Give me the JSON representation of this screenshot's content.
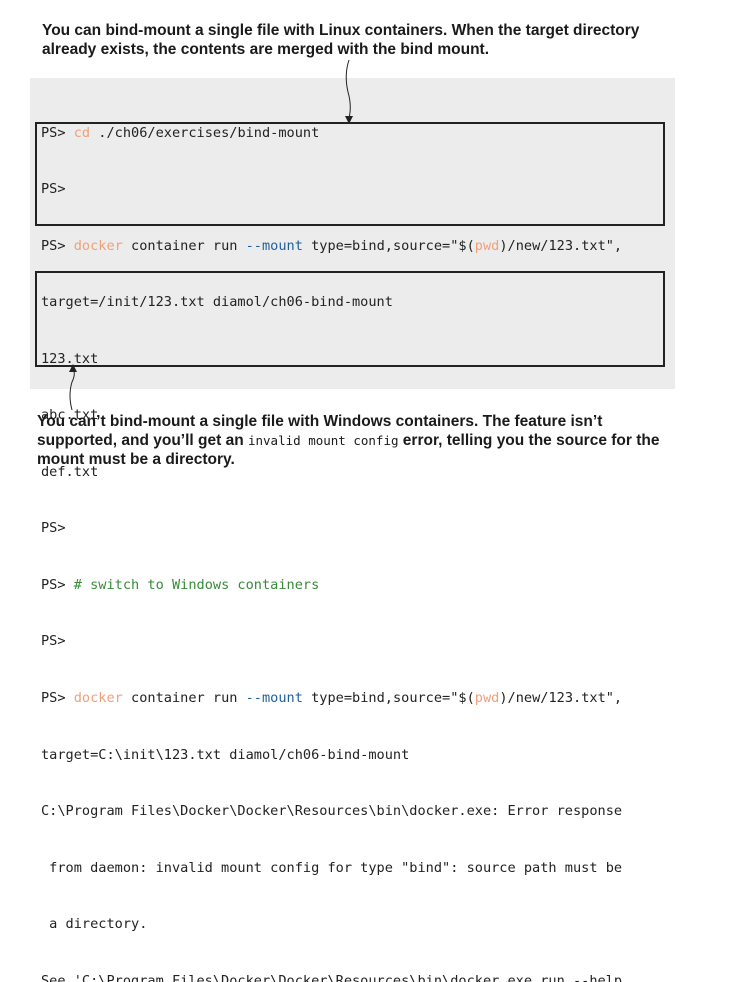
{
  "annotations": {
    "top": "You can bind-mount a single file with Linux containers. When the target directory already exists, the contents are merged with the bind mount.",
    "bottom_part1": "You can’t bind-mount a single file with Windows containers. The feature isn’t supported, and you’ll get an ",
    "bottom_code": "invalid mount config",
    "bottom_part2": " error, telling you the source for the mount must be a directory."
  },
  "terminal": {
    "prompt": "PS> ",
    "l1_cmd": "cd",
    "l1_rest": " ./ch06/exercises/bind-mount",
    "l2": "PS>",
    "l3_cmd": "docker",
    "l3_a": " container run ",
    "l3_opt": "--mount",
    "l3_b": " type=bind,source=\"$(",
    "l3_pwd": "pwd",
    "l3_c": ")/new/123.txt\",",
    "l4": "target=/init/123.txt diamol/ch06-bind-mount",
    "l5": "123.txt",
    "l6": "abc.txt",
    "l7": "def.txt",
    "l8": "PS>",
    "l9_comment": "# switch to Windows containers",
    "l10": "PS>",
    "l11_cmd": "docker",
    "l11_a": " container run ",
    "l11_opt": "--mount",
    "l11_b": " type=bind,source=\"$(",
    "l11_pwd": "pwd",
    "l11_c": ")/new/123.txt\",",
    "l12": "target=C:\\init\\123.txt diamol/ch06-bind-mount",
    "l13": "C:\\Program Files\\Docker\\Docker\\Resources\\bin\\docker.exe: Error response",
    "l14": " from daemon: invalid mount config for type \"bind\": source path must be",
    "l15": " a directory.",
    "l16": "See 'C:\\Program Files\\Docker\\Docker\\Resources\\bin\\docker.exe run --help"
  }
}
